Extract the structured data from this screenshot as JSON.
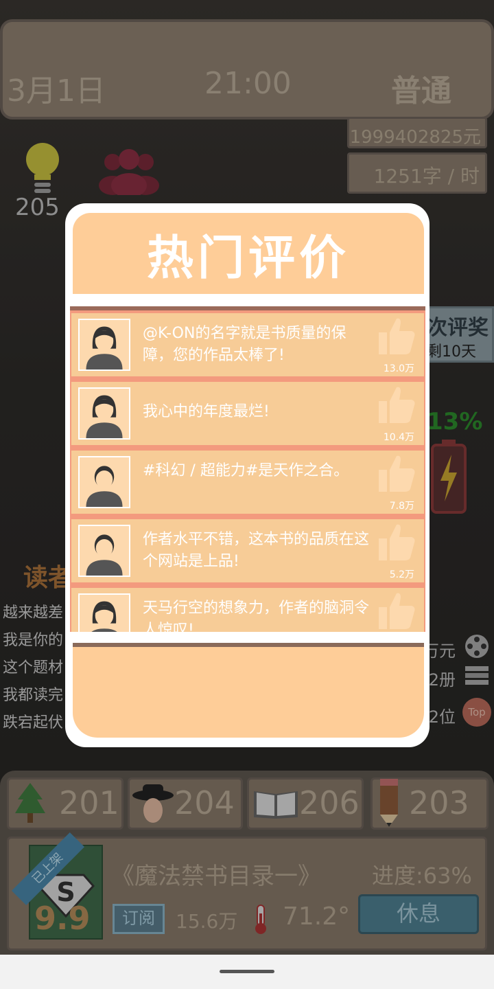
{
  "top": {
    "date": "3月1日",
    "time": "21:00",
    "difficulty": "普通"
  },
  "money": "1999402825元",
  "speed": "1251字 / 时",
  "idea_count": "205",
  "award": {
    "title": "次评奖",
    "days": "剩10天"
  },
  "energy_pct": "13%",
  "reader_section": {
    "title": "读者"
  },
  "reader_comments": [
    "越来越差",
    "我是你的",
    "这个题材",
    "我都读完",
    "跌宕起伏"
  ],
  "stats_right": [
    "万元",
    "2册",
    "2位"
  ],
  "top_badge": "Top",
  "skills": [
    "201",
    "204",
    "206",
    "203"
  ],
  "book": {
    "badge": "已上架",
    "rating": "9.9",
    "title": "《魔法禁书目录一》",
    "progress": "进度:63%",
    "subscribe_label": "订阅",
    "subscribers": "15.6万",
    "temperature": "71.2°",
    "rest_label": "休息"
  },
  "modal": {
    "title": "热门评价",
    "reviews": [
      {
        "text": "@K-ON的名字就是书质量的保障，您的作品太棒了!",
        "likes": "13.0万",
        "avatar": "female"
      },
      {
        "text": "我心中的年度最烂!",
        "likes": "10.4万",
        "avatar": "female"
      },
      {
        "text": "#科幻 / 超能力#是天作之合。",
        "likes": "7.8万",
        "avatar": "male"
      },
      {
        "text": "作者水平不错，这本书的品质在这个网站是上品!",
        "likes": "5.2万",
        "avatar": "male"
      },
      {
        "text": "天马行空的想象力，作者的脑洞令人惊叹!",
        "likes": "",
        "avatar": "female"
      }
    ]
  },
  "colors": {
    "modal_header": "#fecd98",
    "row_bg": "#f7cc97",
    "row_gap": "#f39a7e"
  }
}
